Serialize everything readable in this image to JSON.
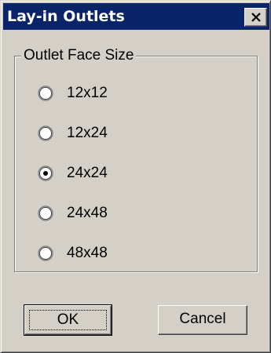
{
  "window": {
    "title": "Lay-in Outlets",
    "close_icon": "close-x-icon"
  },
  "group": {
    "label": "Outlet Face Size",
    "options": [
      {
        "label": "12x12",
        "selected": false
      },
      {
        "label": "12x24",
        "selected": false
      },
      {
        "label": "24x24",
        "selected": true
      },
      {
        "label": "24x48",
        "selected": false
      },
      {
        "label": "48x48",
        "selected": false
      }
    ]
  },
  "buttons": {
    "ok_label": "OK",
    "cancel_label": "Cancel"
  },
  "colors": {
    "titlebar": "#0a246a",
    "face": "#d4d0c8"
  }
}
